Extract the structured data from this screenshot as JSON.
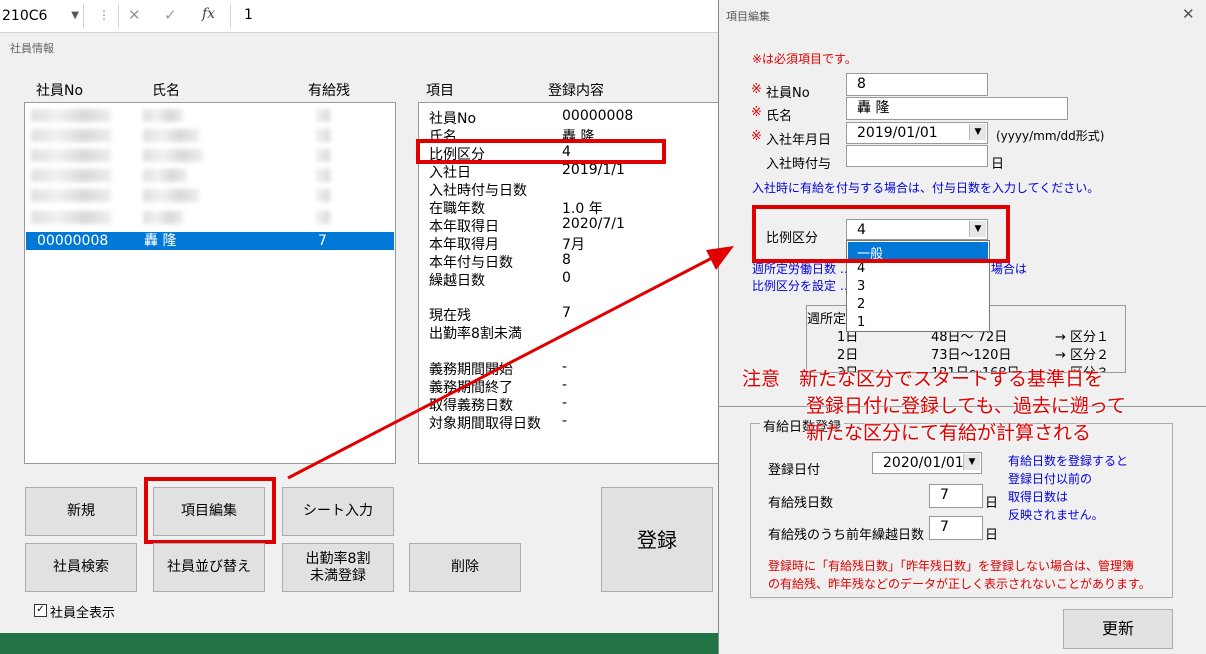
{
  "excel": {
    "name_box": "210C6",
    "formula_value": "1"
  },
  "left_form": {
    "title": "社員情報",
    "list_headers": {
      "emp_no": "社員No",
      "name": "氏名",
      "leave": "有給残"
    },
    "selected_row": {
      "emp_no": "00000008",
      "name": "轟 隆",
      "leave": "7"
    },
    "detail_headers": {
      "item": "項目",
      "content": "登録内容"
    },
    "detail_rows": [
      {
        "label": "社員No",
        "value": "00000008"
      },
      {
        "label": "氏名",
        "value": "轟 隆"
      },
      {
        "label": "比例区分",
        "value": "4"
      },
      {
        "label": "入社日",
        "value": "2019/1/1"
      },
      {
        "label": "入社時付与日数",
        "value": ""
      },
      {
        "label": "在職年数",
        "value": "1.0 年"
      },
      {
        "label": "本年取得日",
        "value": "2020/7/1"
      },
      {
        "label": "本年取得月",
        "value": "7月"
      },
      {
        "label": "本年付与日数",
        "value": "8"
      },
      {
        "label": "繰越日数",
        "value": "0"
      },
      {
        "label": "現在残",
        "value": "7"
      },
      {
        "label": "出勤率8割未満",
        "value": ""
      },
      {
        "label": "義務期間開始",
        "value": "-"
      },
      {
        "label": "義務期間終了",
        "value": "-"
      },
      {
        "label": "取得義務日数",
        "value": "-"
      },
      {
        "label": "対象期間取得日数",
        "value": "-"
      }
    ],
    "buttons": {
      "new": "新規",
      "edit_items": "項目編集",
      "sheet_input": "シート入力",
      "search": "社員検索",
      "sort": "社員並び替え",
      "attendance_line1": "出勤率8割",
      "attendance_line2": "未満登録",
      "delete": "削除",
      "register": "登録"
    },
    "show_all_label": "社員全表示",
    "show_all_checked": true
  },
  "dialog": {
    "title": "項目編集",
    "required_note": "※は必須項目です。",
    "required_mark": "※",
    "fields": {
      "emp_no_label": "社員No",
      "emp_no_value": "8",
      "name_label": "氏名",
      "name_value": "轟 隆",
      "hire_date_label": "入社年月日",
      "hire_date_value": "2019/01/01",
      "hire_date_hint": "(yyyy/mm/dd形式)",
      "grant_label": "入社時付与",
      "grant_unit": "日",
      "grant_note": "入社時に有給を付与する場合は、付与日数を入力してください。",
      "ratio_label": "比例区分",
      "ratio_value": "4"
    },
    "ratio_options": [
      "一般",
      "4",
      "3",
      "2",
      "1"
    ],
    "ratio_note_line1": "週所定労働日数 … 労働時間が30時間未満の場合は",
    "ratio_note_line2": "比例区分を設定 … の労働者になります。",
    "ratio_table": {
      "header": "週所定 … 定労働日数",
      "rows": [
        {
          "days": "1日",
          "range": "48日～ 72日",
          "cls": "→ 区分１"
        },
        {
          "days": "2日",
          "range": "73日～120日",
          "cls": "→ 区分２"
        },
        {
          "days": "3日",
          "range": "121日～168日",
          "cls": "→ 区分３"
        }
      ]
    },
    "leave_section": {
      "title": "有給日数登録",
      "reg_date_label": "登録日付",
      "reg_date_value": "2020/01/01",
      "reg_note": [
        "有給日数を登録すると",
        "登録日付以前の",
        "取得日数は",
        "反映されません。"
      ],
      "remaining_label": "有給残日数",
      "remaining_value": "7",
      "carry_label": "有給残のうち前年繰越日数",
      "carry_value": "7",
      "unit": "日",
      "warning_line1": "登録時に「有給残日数」「昨年残日数」を登録しない場合は、管理簿",
      "warning_line2": "の有給残、昨年残などのデータが正しく表示されないことがあります。"
    },
    "update_button": "更新"
  },
  "annotation": {
    "line1": "注意　新たな区分でスタートする基準日を",
    "line2": "登録日付に登録しても、過去に遡って",
    "line3": "新たな区分にて有給が計算される",
    "color": "#e00000"
  }
}
